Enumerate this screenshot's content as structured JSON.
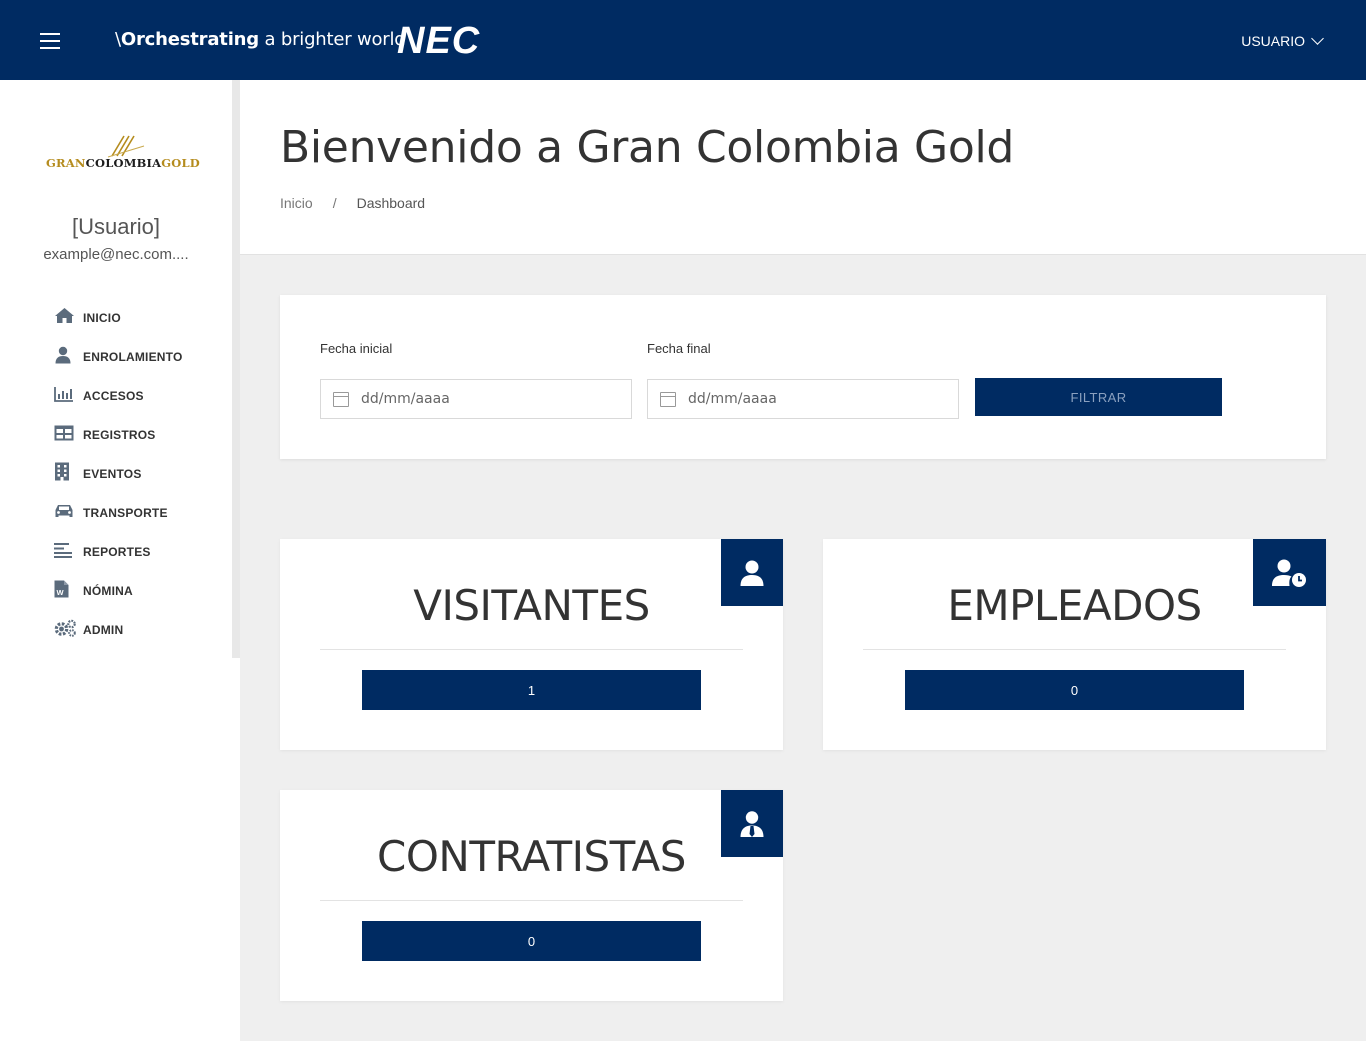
{
  "header": {
    "tagline_prefix": "\\",
    "tagline_bold": "Orchestrating",
    "tagline_rest": " a brighter world",
    "logo": "NEC",
    "user_menu": "USUARIO"
  },
  "sidebar": {
    "brand": {
      "left": "GRAN",
      "middle": "COLOMBIA",
      "right": "GOLD"
    },
    "user_name": "[Usuario]",
    "user_email": "example@nec.com....",
    "items": [
      {
        "label": "INICIO",
        "icon": "home-icon"
      },
      {
        "label": "ENROLAMIENTO",
        "icon": "user-icon"
      },
      {
        "label": "ACCESOS",
        "icon": "bar-chart-icon"
      },
      {
        "label": "REGISTROS",
        "icon": "table-icon"
      },
      {
        "label": "EVENTOS",
        "icon": "building-icon"
      },
      {
        "label": "TRANSPORTE",
        "icon": "car-icon"
      },
      {
        "label": "REPORTES",
        "icon": "list-icon"
      },
      {
        "label": "NÓMINA",
        "icon": "word-document-icon"
      },
      {
        "label": "ADMIN",
        "icon": "gears-icon"
      }
    ]
  },
  "page": {
    "title": "Bienvenido a Gran Colombia Gold",
    "breadcrumb": {
      "home": "Inicio",
      "separator": "/",
      "current": "Dashboard"
    }
  },
  "filter": {
    "start_label": "Fecha inicial",
    "start_placeholder": "dd/mm/aaaa",
    "end_label": "Fecha final",
    "end_placeholder": "dd/mm/aaaa",
    "button": "FILTRAR"
  },
  "stats": {
    "visitantes": {
      "title": "VISITANTES",
      "value": "1",
      "icon": "user-icon"
    },
    "empleados": {
      "title": "EMPLEADOS",
      "value": "0",
      "icon": "user-clock-icon"
    },
    "contratistas": {
      "title": "CONTRATISTAS",
      "value": "0",
      "icon": "user-tie-icon"
    }
  },
  "colors": {
    "primary": "#002b62",
    "brand_gold": "#b58c1e",
    "background": "#efefef"
  }
}
